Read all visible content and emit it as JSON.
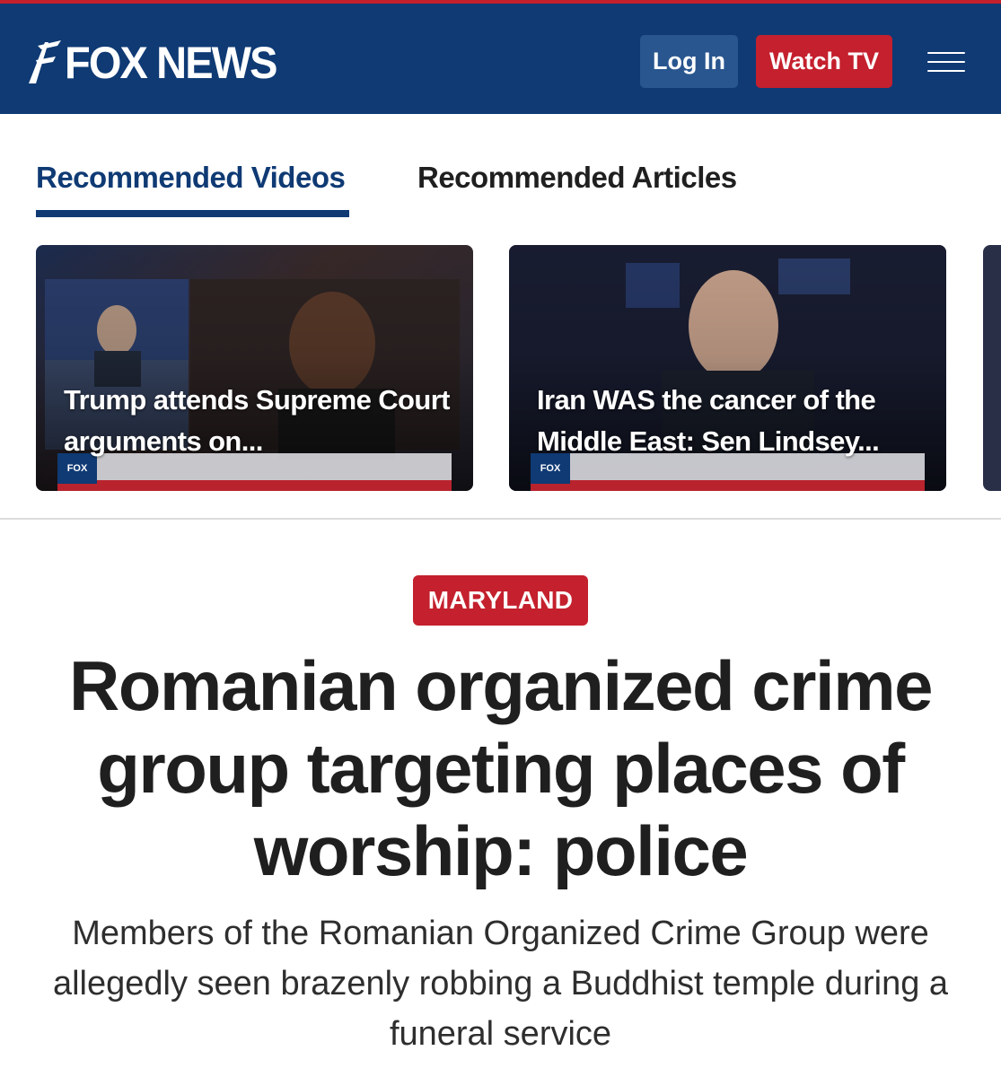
{
  "header": {
    "logo_text": "FOX NEWS",
    "login_label": "Log In",
    "watch_label": "Watch TV",
    "menu_icon": "hamburger-menu-icon",
    "colors": {
      "brand_blue": "#0f3a74",
      "brand_red": "#c4202d",
      "login_bg": "#29568f"
    }
  },
  "tabs": [
    {
      "label": "Recommended Videos",
      "active": true
    },
    {
      "label": "Recommended Articles",
      "active": false
    }
  ],
  "videos": [
    {
      "title": "Trump attends Supreme Court arguments on..."
    },
    {
      "title": "Iran WAS the cancer of the Middle East: Sen Lindsey..."
    }
  ],
  "article": {
    "category": "MARYLAND",
    "headline": "Romanian organized crime group targeting places of worship: police",
    "subheadline": "Members of the Romanian Organized Crime Group were allegedly seen brazenly robbing a Buddhist temple during a funeral service"
  }
}
